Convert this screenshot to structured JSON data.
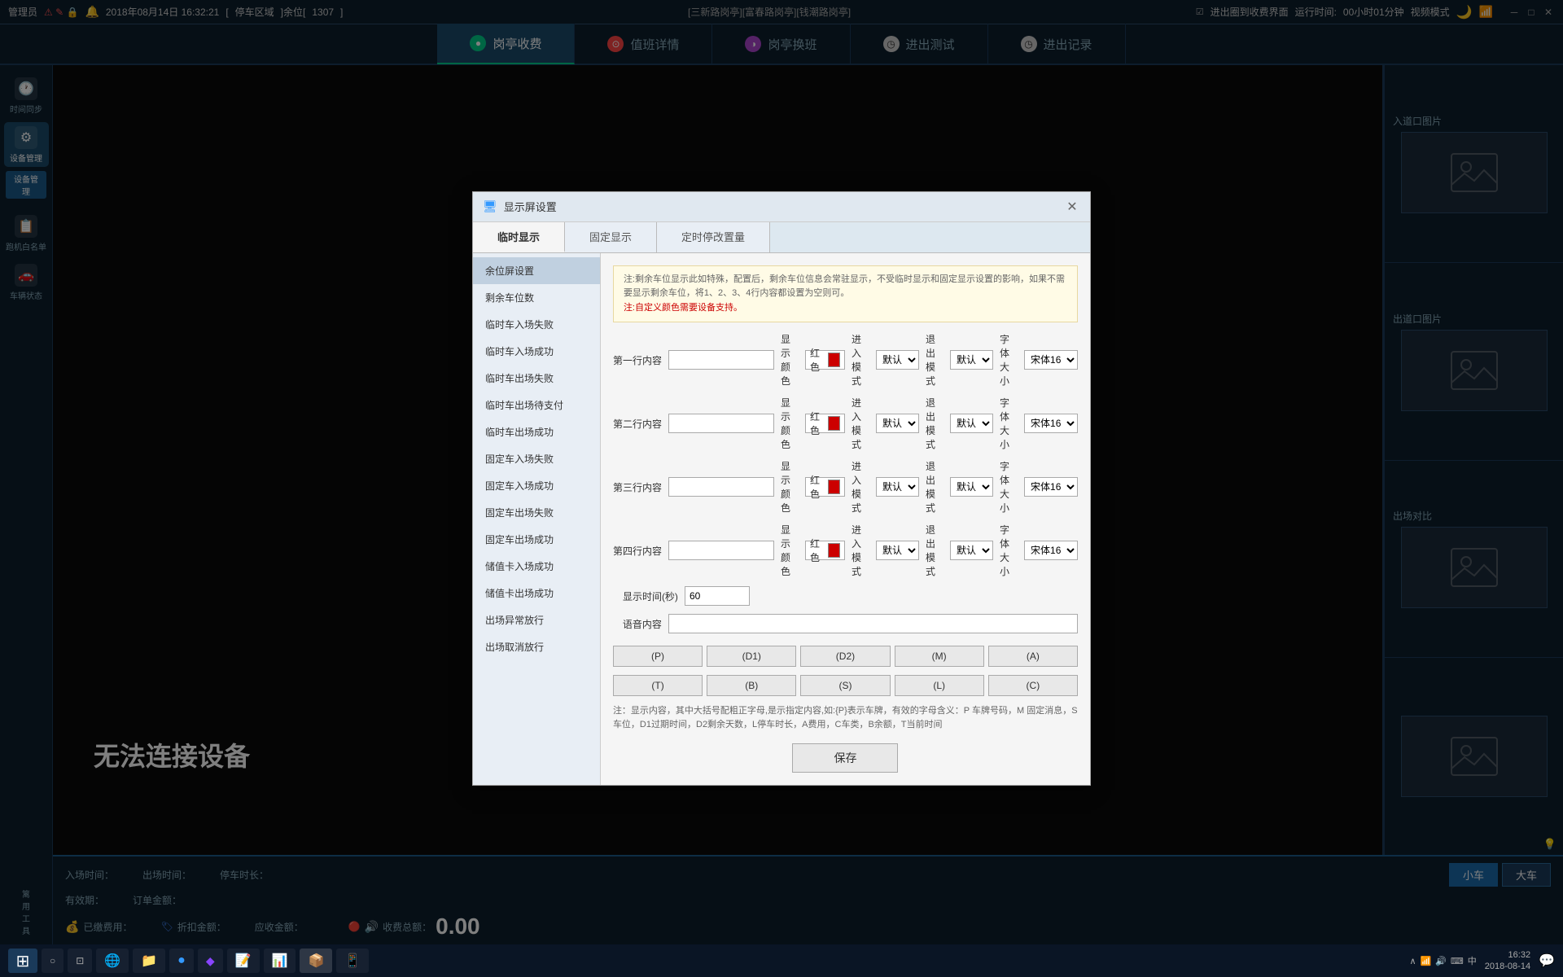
{
  "topbar": {
    "user": "管理员",
    "datetime": "2018年08月14日 16:32:21",
    "parking_label": "停车区域",
    "remaining_label": "余位",
    "remaining_count": "1307",
    "location": "[三新路岗亭][富春路岗亭][钱潮路岗亭]",
    "entry_exit_label": "进出圈到收费界面",
    "runtime_label": "运行时间:",
    "runtime_value": "00小时01分钟",
    "video_mode": "视频模式",
    "minimize": "─",
    "maximize": "□",
    "close": "✕"
  },
  "nav": {
    "tabs": [
      {
        "id": "tab1",
        "icon": "●",
        "label": "岗亭收费",
        "active": true
      },
      {
        "id": "tab2",
        "icon": "⊙",
        "label": "值班详情",
        "active": false
      },
      {
        "id": "tab3",
        "icon": "◑",
        "label": "岗亭换班",
        "active": false
      },
      {
        "id": "tab4",
        "icon": "◷",
        "label": "进出测试",
        "active": false
      },
      {
        "id": "tab5",
        "icon": "◷",
        "label": "进出记录",
        "active": false
      }
    ]
  },
  "sidebar": {
    "items": [
      {
        "id": "time-sync",
        "icon": "🕐",
        "label": "时间同步"
      },
      {
        "id": "device-mgmt",
        "icon": "⚙",
        "label": "设备管理",
        "active": true
      },
      {
        "id": "device-btn",
        "label": "设备管理"
      },
      {
        "id": "whitelist",
        "icon": "📋",
        "label": "跑机白名单"
      },
      {
        "id": "vehicle-status",
        "icon": "🚗",
        "label": "车辆状态"
      }
    ]
  },
  "main": {
    "no_connection": "无法连接设备"
  },
  "right_panels": {
    "entry_title": "入道口图片",
    "exit_title": "出道口图片",
    "compare_title": "出场对比"
  },
  "bottom": {
    "entry_time_label": "入场时间：",
    "exit_time_label": "出场时间：",
    "duration_label": "停车时长：",
    "valid_label": "有效期：",
    "order_label": "订单金额：",
    "small_car": "小车",
    "big_car": "大车",
    "paid_label": "已缴费用：",
    "discount_label": "折扣金额：",
    "receivable_label": "应收金额：",
    "total_label": "收费总额：",
    "total_amount": "0.00"
  },
  "dialog": {
    "title": "显示屏设置",
    "close": "✕",
    "tabs": [
      {
        "label": "临时显示",
        "active": true
      },
      {
        "label": "固定显示",
        "active": false
      },
      {
        "label": "定时停改置量",
        "active": false
      }
    ],
    "menu_items": [
      {
        "label": "余位屏设置"
      },
      {
        "label": "剩余车位数"
      },
      {
        "label": "临时车入场失败"
      },
      {
        "label": "临时车入场成功"
      },
      {
        "label": "临时车出场失败"
      },
      {
        "label": "临时车出场待支付"
      },
      {
        "label": "临时车出场成功"
      },
      {
        "label": "固定车入场失败"
      },
      {
        "label": "固定车入场成功"
      },
      {
        "label": "固定车出场失败"
      },
      {
        "label": "固定车出场成功"
      },
      {
        "label": "储值卡入场成功"
      },
      {
        "label": "储值卡出场成功"
      },
      {
        "label": "出场异常放行"
      },
      {
        "label": "出场取消放行"
      }
    ],
    "notice": {
      "line1": "注:剩余车位显示此如特殊，配置后，剩余车位信息会常驻显示，不受临时显示和固定显示设置的影响，如果不需要显示剩余车位，将1、2、3、4行内容都设置为空则可。",
      "line2": "注:自定义颜色需要设备支持。"
    },
    "rows": [
      {
        "label": "第一行内容",
        "input_value": "",
        "color": "红色",
        "entry_mode_label": "进入模式",
        "entry_mode": "默认",
        "exit_mode_label": "退出模式",
        "exit_mode": "默认",
        "font_size_label": "字体大小",
        "font_value": "宋体16"
      },
      {
        "label": "第二行内容",
        "input_value": "",
        "color": "红色",
        "entry_mode_label": "进入模式",
        "entry_mode": "默认",
        "exit_mode_label": "退出模式",
        "exit_mode": "默认",
        "font_size_label": "字体大小",
        "font_value": "宋体16"
      },
      {
        "label": "第三行内容",
        "input_value": "",
        "color": "红色",
        "entry_mode_label": "进入模式",
        "entry_mode": "默认",
        "exit_mode_label": "退出模式",
        "exit_mode": "默认",
        "font_size_label": "字体大小",
        "font_value": "宋体16"
      },
      {
        "label": "第四行内容",
        "input_value": "",
        "color": "红色",
        "entry_mode_label": "进入模式",
        "entry_mode": "默认",
        "exit_mode_label": "退出模式",
        "exit_mode": "默认",
        "font_size_label": "字体大小",
        "font_value": "宋体16"
      }
    ],
    "display_time_label": "显示时间(秒)",
    "display_time_value": "60",
    "voice_label": "语音内容",
    "voice_value": "",
    "btn_grid_row1": [
      "(P)",
      "(D1)",
      "(D2)",
      "(M)",
      "(A)"
    ],
    "btn_grid_row2": [
      "(T)",
      "(B)",
      "(S)",
      "(L)",
      "(C)"
    ],
    "hint": "注：显示内容，其中大括号配粗正字母,是示指定内容,如:{P}表示车牌，有效的字母含义：P 车牌号码，M 固定消息，S 车位，D1过期时间，D2剩余天数，L停车时长，A费用，C车类，B余额，T当前时间",
    "save_label": "保存"
  },
  "taskbar": {
    "time": "16:32",
    "date": "2018-08-14",
    "items": [
      "⊞",
      "○",
      "⊡",
      "🌐",
      "📁",
      "🔵",
      "📝",
      "📊",
      "📦",
      "📱"
    ],
    "system_icons": [
      "🔊",
      "⌨",
      "中",
      "∧"
    ]
  }
}
